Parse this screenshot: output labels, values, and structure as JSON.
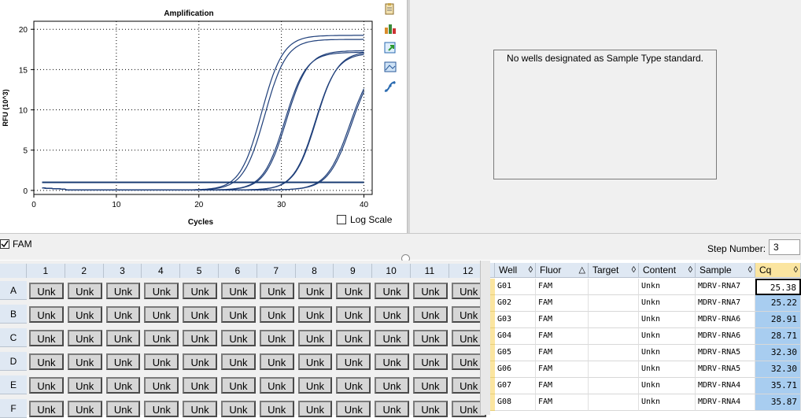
{
  "chart": {
    "title": "Amplification",
    "xlabel": "Cycles",
    "ylabel": "RFU (10^3)",
    "log_scale_label": "Log Scale",
    "log_scale_checked": false,
    "line_color": "#1f3f7a",
    "threshold_color": "#1a3d73"
  },
  "chart_data": {
    "type": "line",
    "title": "Amplification",
    "xlabel": "Cycles",
    "ylabel": "RFU (10^3)",
    "xlim": [
      0,
      41
    ],
    "ylim": [
      -0.5,
      21
    ],
    "x_ticks": [
      0,
      10,
      20,
      30,
      40
    ],
    "y_ticks": [
      0,
      5,
      10,
      15,
      20
    ],
    "grid": true,
    "threshold": 1.0,
    "series": [
      {
        "plateau": 19.2,
        "midpoint": 27.6,
        "slope": 1.3
      },
      {
        "plateau": 18.7,
        "midpoint": 28.0,
        "slope": 1.3
      },
      {
        "plateau": 17.3,
        "midpoint": 30.6,
        "slope": 1.3
      },
      {
        "plateau": 17.1,
        "midpoint": 30.4,
        "slope": 1.3
      },
      {
        "plateau": 17.2,
        "midpoint": 34.2,
        "slope": 1.3
      },
      {
        "plateau": 17.0,
        "midpoint": 34.1,
        "slope": 1.3
      },
      {
        "plateau": 16.3,
        "midpoint": 38.3,
        "slope": 1.4
      },
      {
        "plateau": 16.4,
        "midpoint": 38.5,
        "slope": 1.4
      }
    ]
  },
  "toolbar_icons": [
    "copy-icon",
    "chart-settings-icon",
    "export-icon",
    "image-icon",
    "trend-icon"
  ],
  "standard_panel": {
    "message": "No wells designated as Sample Type standard."
  },
  "fluor_toggle": {
    "label": "FAM",
    "checked": true
  },
  "step": {
    "label": "Step Number:",
    "value": "3"
  },
  "plate": {
    "columns": [
      "1",
      "2",
      "3",
      "4",
      "5",
      "6",
      "7",
      "8",
      "9",
      "10",
      "11",
      "12"
    ],
    "rows": [
      "A",
      "B",
      "C",
      "D",
      "E",
      "F"
    ],
    "well_label": "Unk"
  },
  "table": {
    "headers": [
      "Well",
      "Fluor",
      "Target",
      "Content",
      "Sample",
      "Cq"
    ],
    "sort_marks": [
      "◊",
      "△",
      "◊",
      "◊",
      "◊",
      "◊"
    ],
    "rows": [
      {
        "well": "G01",
        "fluor": "FAM",
        "target": "",
        "content": "Unkn",
        "sample": "MDRV-RNA7",
        "cq": "25.38"
      },
      {
        "well": "G02",
        "fluor": "FAM",
        "target": "",
        "content": "Unkn",
        "sample": "MDRV-RNA7",
        "cq": "25.22"
      },
      {
        "well": "G03",
        "fluor": "FAM",
        "target": "",
        "content": "Unkn",
        "sample": "MDRV-RNA6",
        "cq": "28.91"
      },
      {
        "well": "G04",
        "fluor": "FAM",
        "target": "",
        "content": "Unkn",
        "sample": "MDRV-RNA6",
        "cq": "28.71"
      },
      {
        "well": "G05",
        "fluor": "FAM",
        "target": "",
        "content": "Unkn",
        "sample": "MDRV-RNA5",
        "cq": "32.30"
      },
      {
        "well": "G06",
        "fluor": "FAM",
        "target": "",
        "content": "Unkn",
        "sample": "MDRV-RNA5",
        "cq": "32.30"
      },
      {
        "well": "G07",
        "fluor": "FAM",
        "target": "",
        "content": "Unkn",
        "sample": "MDRV-RNA4",
        "cq": "35.71"
      },
      {
        "well": "G08",
        "fluor": "FAM",
        "target": "",
        "content": "Unkn",
        "sample": "MDRV-RNA4",
        "cq": "35.87"
      }
    ]
  }
}
